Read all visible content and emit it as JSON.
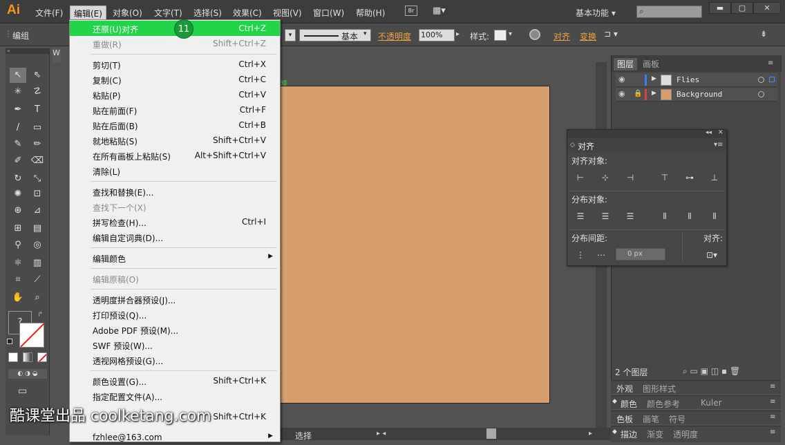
{
  "app": {
    "logo": "Ai"
  },
  "menubar": {
    "items": [
      "文件(F)",
      "编辑(E)",
      "对象(O)",
      "文字(T)",
      "选择(S)",
      "效果(C)",
      "视图(V)",
      "窗口(W)",
      "帮助(H)"
    ],
    "bridge": "Br",
    "workspace": "基本功能",
    "search_icon": "⌕"
  },
  "controlbar": {
    "label": "编组",
    "stroke_style": "基本",
    "opacity_label": "不透明度",
    "opacity_value": "100%",
    "style_label": "样式:",
    "align_label": "对齐",
    "transform_label": "变换"
  },
  "edit_menu": {
    "items": [
      {
        "label": "还原(U)对齐",
        "shortcut": "Ctrl+Z"
      },
      {
        "label": "重做(R)",
        "shortcut": "Shift+Ctrl+Z"
      },
      {
        "label": "剪切(T)",
        "shortcut": "Ctrl+X"
      },
      {
        "label": "复制(C)",
        "shortcut": "Ctrl+C"
      },
      {
        "label": "粘贴(P)",
        "shortcut": "Ctrl+V"
      },
      {
        "label": "贴在前面(F)",
        "shortcut": "Ctrl+F"
      },
      {
        "label": "贴在后面(B)",
        "shortcut": "Ctrl+B"
      },
      {
        "label": "就地粘贴(S)",
        "shortcut": "Shift+Ctrl+V"
      },
      {
        "label": "在所有画板上粘贴(S)",
        "shortcut": "Alt+Shift+Ctrl+V"
      },
      {
        "label": "清除(L)",
        "shortcut": ""
      },
      {
        "label": "查找和替换(E)...",
        "shortcut": ""
      },
      {
        "label": "查找下一个(X)",
        "shortcut": ""
      },
      {
        "label": "拼写检查(H)...",
        "shortcut": "Ctrl+I"
      },
      {
        "label": "编辑自定词典(D)...",
        "shortcut": ""
      },
      {
        "label": "编辑颜色",
        "shortcut": ""
      },
      {
        "label": "编辑原稿(O)",
        "shortcut": ""
      },
      {
        "label": "透明度拼合器预设(J)...",
        "shortcut": ""
      },
      {
        "label": "打印预设(Q)...",
        "shortcut": ""
      },
      {
        "label": "Adobe PDF 预设(M)...",
        "shortcut": ""
      },
      {
        "label": "SWF 预设(W)...",
        "shortcut": ""
      },
      {
        "label": "透视网格预设(G)...",
        "shortcut": ""
      },
      {
        "label": "颜色设置(G)...",
        "shortcut": "Shift+Ctrl+K"
      },
      {
        "label": "指定配置文件(A)...",
        "shortcut": ""
      },
      {
        "label": "",
        "shortcut": "Shift+Ctrl+K"
      },
      {
        "label": "fzhlee@163.com",
        "shortcut": ""
      }
    ],
    "step_badge": "11"
  },
  "toolbox": {
    "swatch_label": "?"
  },
  "document": {
    "tab": "W",
    "green_label": "矮",
    "status_mode": "选择"
  },
  "layers_panel": {
    "tabs": [
      "图层",
      "画板"
    ],
    "layers": [
      {
        "name": "Flies",
        "color": "#3a7cff"
      },
      {
        "name": "Background",
        "color": "#e04040"
      }
    ],
    "count": "2 个图层"
  },
  "panel_strips": [
    {
      "tabs": [
        "外观",
        "图形样式"
      ]
    },
    {
      "tabs": [
        "颜色",
        "颜色参考",
        "Kuler"
      ]
    },
    {
      "tabs": [
        "色板",
        "画笔",
        "符号"
      ]
    },
    {
      "tabs": [
        "描边",
        "渐变",
        "透明度"
      ]
    }
  ],
  "align_panel": {
    "title": "对齐",
    "align_objects": "对齐对象:",
    "distribute_objects": "分布对象:",
    "distribute_spacing": "分布间距:",
    "align_to": "对齐:",
    "spacing_value": "0 px"
  },
  "watermark": "酷课堂出品 coolketang.com",
  "colors": {
    "highlight": "#22d44a",
    "artboard": "#d69e6d",
    "accent": "#f0a040"
  }
}
